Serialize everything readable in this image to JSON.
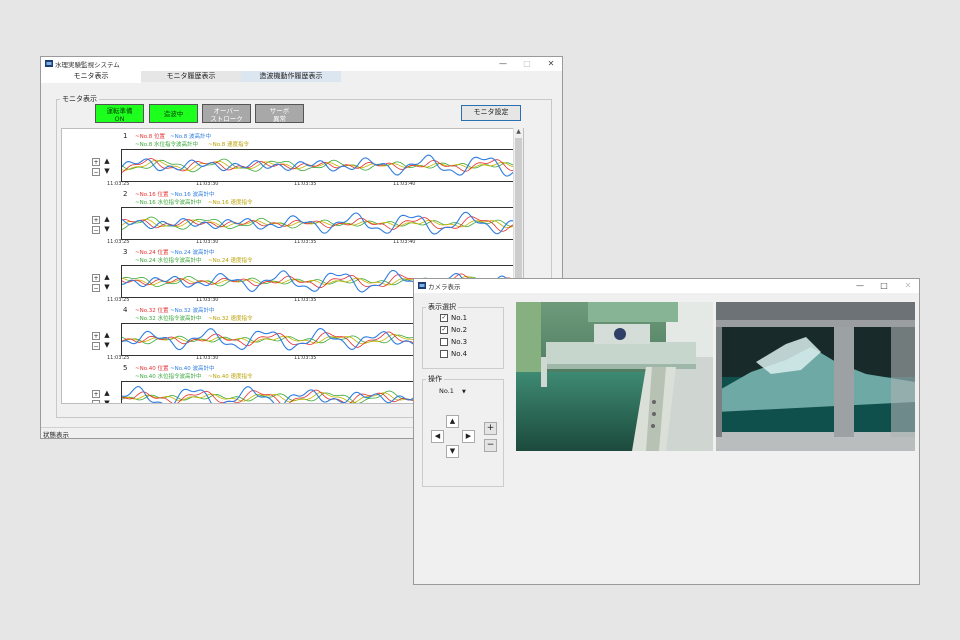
{
  "main_window": {
    "title": "水理実験監視システム",
    "tabs": [
      {
        "label": "モニタ表示"
      },
      {
        "label": "モニタ履歴表示"
      },
      {
        "label": "造波機動作履歴表示"
      }
    ],
    "group_label": "モニタ表示",
    "status_buttons": [
      {
        "line1": "運転準備",
        "line2": "ON",
        "color": "#1dff1d"
      },
      {
        "line1": "造波中",
        "line2": "",
        "color": "#1dff1d"
      },
      {
        "line1": "オーバー",
        "line2": "ストローク",
        "color": "#a8a8a8"
      },
      {
        "line1": "サーボ",
        "line2": "異常",
        "color": "#a8a8a8"
      }
    ],
    "settings_button": "モニタ設定",
    "status_bar": "状態表示"
  },
  "monitors": [
    {
      "num": "1",
      "leg_pos": "~No.8 位置",
      "leg_wave": "~No.8 波高計中",
      "leg_cmd": "~No.8 水位指令波高計中",
      "leg_speed": "~No.8 速度指令",
      "ticks": [
        "11:03:25",
        "11:03:30",
        "11:03:35",
        "11:03:40"
      ]
    },
    {
      "num": "2",
      "leg_pos": "~No.16 位置",
      "leg_wave": "~No.16 波高計中",
      "leg_cmd": "~No.16 水位指令波高計中",
      "leg_speed": "~No.16 速度指令",
      "ticks": [
        "11:03:25",
        "11:03:30",
        "11:03:35",
        "11:03:40"
      ]
    },
    {
      "num": "3",
      "leg_pos": "~No.24 位置",
      "leg_wave": "~No.24 波高計中",
      "leg_cmd": "~No.24 水位指令波高計中",
      "leg_speed": "~No.24 速度指令",
      "ticks": [
        "11:03:25",
        "11:03:30",
        "11:03:35",
        ""
      ]
    },
    {
      "num": "4",
      "leg_pos": "~No.32 位置",
      "leg_wave": "~No.32 波高計中",
      "leg_cmd": "~No.32 水位指令波高計中",
      "leg_speed": "~No.32 速度指令",
      "ticks": [
        "11:03:25",
        "11:03:30",
        "11:03:35",
        ""
      ]
    },
    {
      "num": "5",
      "leg_pos": "~No.40 位置",
      "leg_wave": "~No.40 波高計中",
      "leg_cmd": "~No.40 水位指令波高計中",
      "leg_speed": "~No.40 速度指令",
      "ticks": [
        "",
        "",
        "",
        ""
      ]
    }
  ],
  "series_colors": {
    "pos": "#e53030",
    "wave": "#2f7de0",
    "cmd": "#3aa83a",
    "speed": "#c8b400"
  },
  "camera_window": {
    "title": "カメラ表示",
    "select_group_label": "表示選択",
    "cameras": [
      {
        "label": "No.1",
        "checked": true
      },
      {
        "label": "No.2",
        "checked": true
      },
      {
        "label": "No.3",
        "checked": false
      },
      {
        "label": "No.4",
        "checked": false
      }
    ],
    "operation_label": "操作",
    "selected_camera": "No.1",
    "zoom_in": "+",
    "zoom_out": "−"
  }
}
